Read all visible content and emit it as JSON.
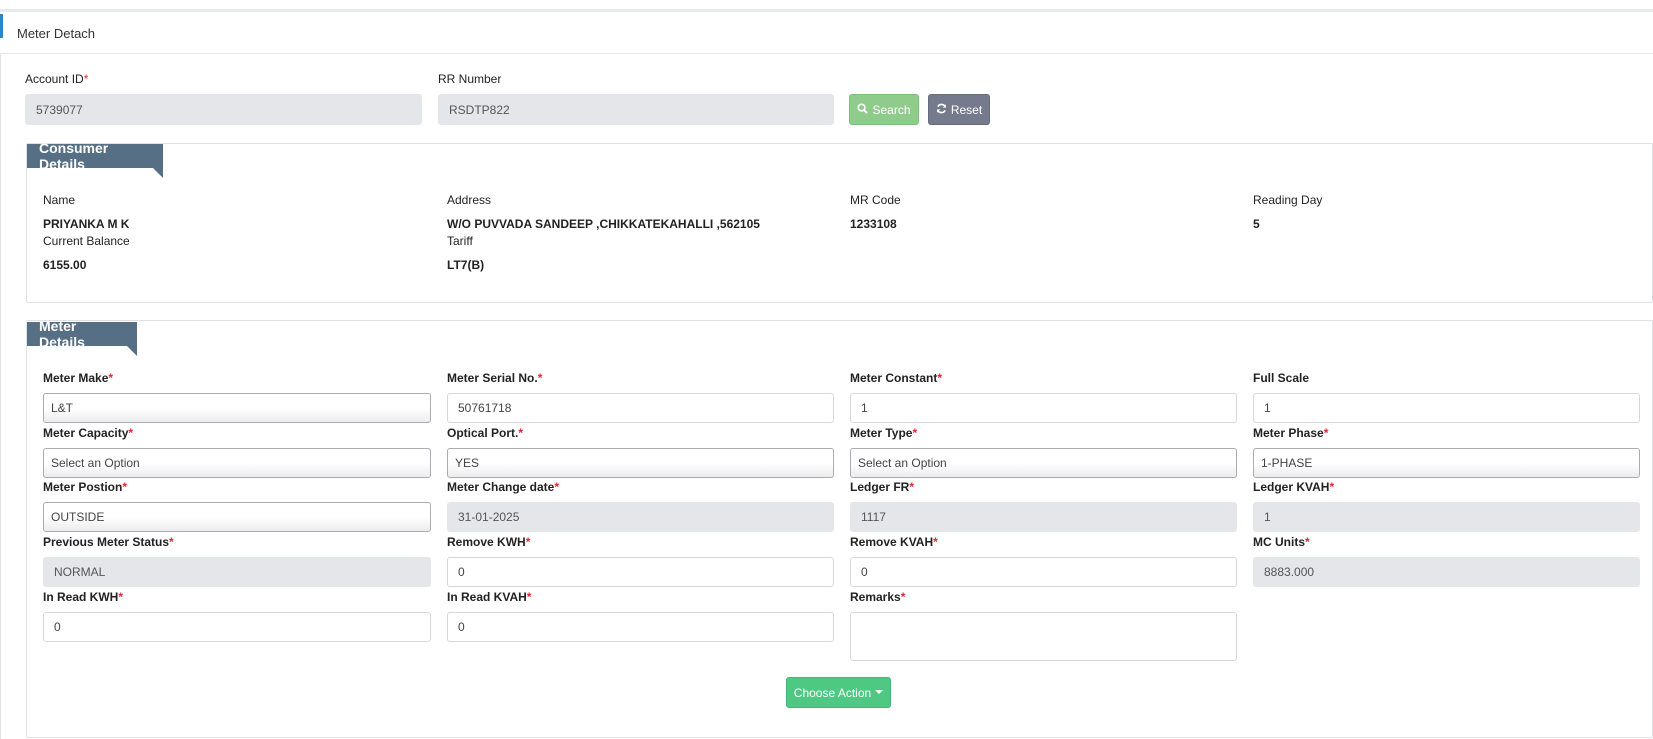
{
  "page": {
    "title": "Meter Detach"
  },
  "search": {
    "account_id_label": "Account ID",
    "account_id_value": "5739077",
    "rr_number_label": "RR Number",
    "rr_number_value": "RSDTP822",
    "search_label": "Search",
    "reset_label": "Reset",
    "required_mark": "*"
  },
  "consumer": {
    "header": "Consumer Details",
    "name_label": "Name",
    "name_value": "PRIYANKA M K",
    "address_label": "Address",
    "address_value": "W/O PUVVADA SANDEEP ,CHIKKATEKAHALLI ,562105",
    "mr_code_label": "MR Code",
    "mr_code_value": "1233108",
    "reading_day_label": "Reading Day",
    "reading_day_value": "5",
    "current_balance_label": "Current Balance",
    "current_balance_value": "6155.00",
    "tariff_label": "Tariff",
    "tariff_value": "LT7(B)"
  },
  "meter": {
    "header": "Meter Details",
    "meter_make_label": "Meter Make",
    "meter_make_value": "L&T",
    "meter_serial_label": "Meter Serial No.",
    "meter_serial_value": "50761718",
    "meter_constant_label": "Meter Constant",
    "meter_constant_value": "1",
    "full_scale_label": "Full Scale",
    "full_scale_value": "1",
    "meter_capacity_label": "Meter Capacity",
    "meter_capacity_value": "Select an Option",
    "optical_port_label": "Optical Port.",
    "optical_port_value": "YES",
    "meter_type_label": "Meter Type",
    "meter_type_value": "Select an Option",
    "meter_phase_label": "Meter Phase",
    "meter_phase_value": "1-PHASE",
    "meter_position_label": "Meter Postion",
    "meter_position_value": "OUTSIDE",
    "meter_change_date_label": "Meter Change date",
    "meter_change_date_value": "31-01-2025",
    "ledger_fr_label": "Ledger FR",
    "ledger_fr_value": "1117",
    "ledger_kvah_label": "Ledger KVAH",
    "ledger_kvah_value": "1",
    "previous_status_label": "Previous Meter Status",
    "previous_status_value": "NORMAL",
    "remove_kwh_label": "Remove KWH",
    "remove_kwh_value": "0",
    "remove_kvah_label": "Remove KVAH",
    "remove_kvah_value": "0",
    "mc_units_label": "MC Units",
    "mc_units_value": "8883.000",
    "in_read_kwh_label": "In Read KWH",
    "in_read_kwh_value": "0",
    "in_read_kvah_label": "In Read KVAH",
    "in_read_kvah_value": "0",
    "remarks_label": "Remarks",
    "remarks_value": "",
    "choose_action_label": "Choose Action"
  },
  "colors": {
    "accent_blue": "#2e86c1",
    "ribbon": "#566f84",
    "search_green": "#8fcc8c",
    "reset_gray": "#767a8d",
    "action_green": "#4fc884",
    "required_red": "#e3262c"
  },
  "icons": {
    "search": "search-icon",
    "reset": "refresh-icon",
    "dropdown": "caret-down-icon"
  }
}
